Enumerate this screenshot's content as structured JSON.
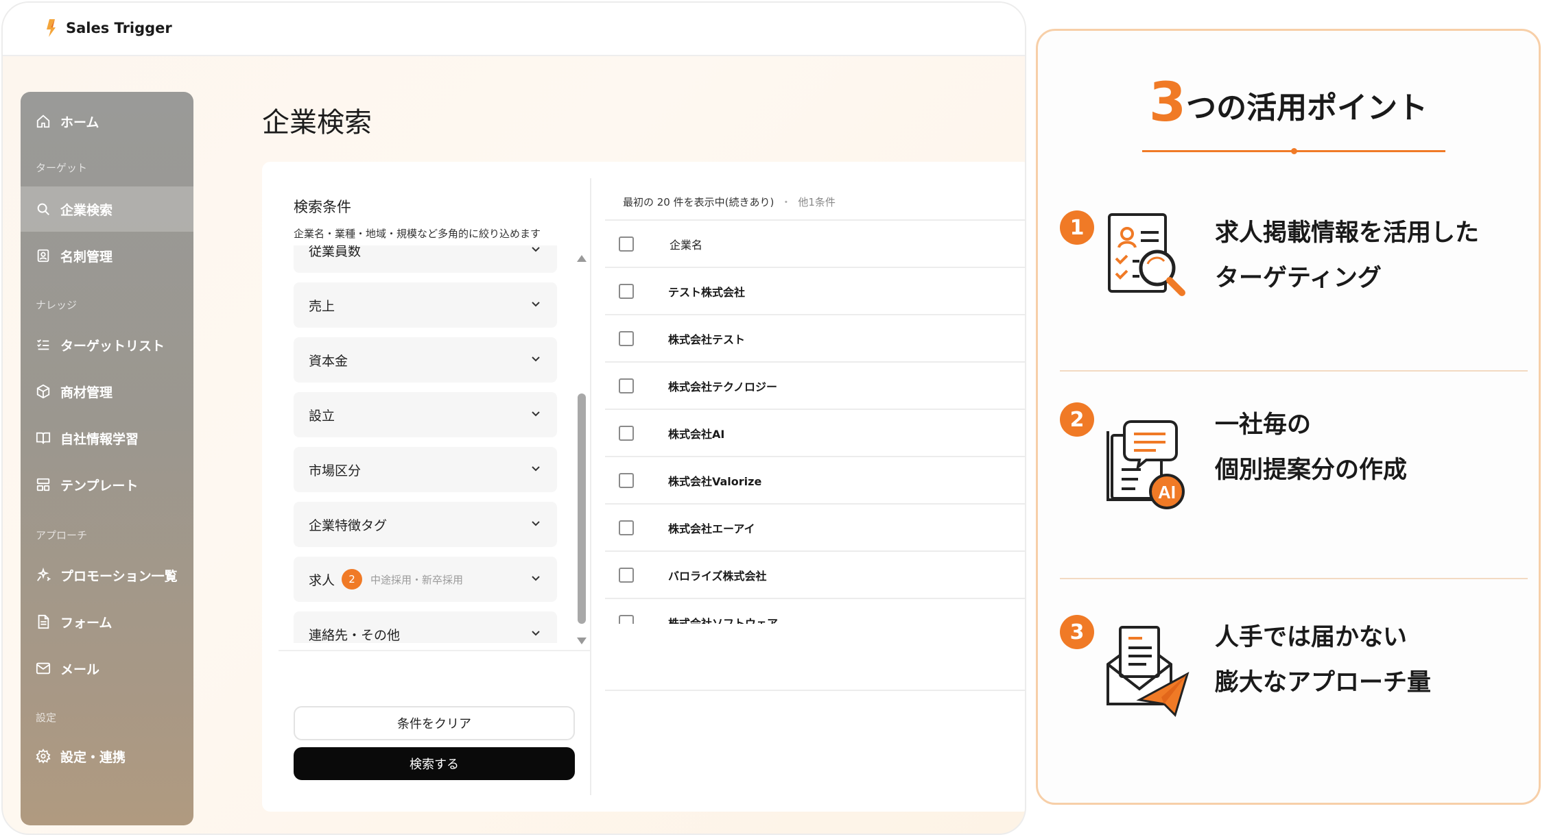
{
  "app": {
    "logo_text": "Sales Trigger"
  },
  "sidebar": {
    "home": "ホーム",
    "section_target": "ターゲット",
    "company_search": "企業検索",
    "business_cards": "名刺管理",
    "section_knowledge": "ナレッジ",
    "target_list": "ターゲットリスト",
    "product_mgmt": "商材管理",
    "company_info": "自社情報学習",
    "template": "テンプレート",
    "section_approach": "アプローチ",
    "promotions": "プロモーション一覧",
    "form": "フォーム",
    "mail": "メール",
    "section_settings": "設定",
    "settings": "設定・連携"
  },
  "main": {
    "page_title": "企業検索",
    "conditions_title": "検索条件",
    "conditions_desc": "企業名・業種・地域・規模など多角的に絞り込めます",
    "filters": [
      {
        "label": "従業員数"
      },
      {
        "label": "売上"
      },
      {
        "label": "資本金"
      },
      {
        "label": "設立"
      },
      {
        "label": "市場区分"
      },
      {
        "label": "企業特徴タグ"
      },
      {
        "label": "求人",
        "badge": "2",
        "sub": "中途採用・新卒採用"
      },
      {
        "label": "連絡先・その他"
      }
    ],
    "clear_button": "条件をクリア",
    "search_button": "検索する",
    "result_info": "最初の 20 件を表示中(続きあり)",
    "result_sep": "・",
    "result_other": "他1条件",
    "table_header": "企業名",
    "rows": [
      "テスト株式会社",
      "株式会社テスト",
      "株式会社テクノロジー",
      "株式会社AI",
      "株式会社Valorize",
      "株式会社エーアイ",
      "バロライズ株式会社",
      "株式会社ソフトウェア"
    ]
  },
  "promo": {
    "title_number": "3",
    "title_rest": "つの活用ポイント",
    "accent_color": "#f07a26",
    "points": [
      {
        "num": "1",
        "icon": "resume-search-icon",
        "line1": "求人掲載情報を活用した",
        "line2": "ターゲティング"
      },
      {
        "num": "2",
        "icon": "ai-document-icon",
        "line1": "一社毎の",
        "line2": "個別提案分の作成"
      },
      {
        "num": "3",
        "icon": "mail-send-icon",
        "line1": "人手では届かない",
        "line2": "膨大なアプローチ量"
      }
    ]
  }
}
